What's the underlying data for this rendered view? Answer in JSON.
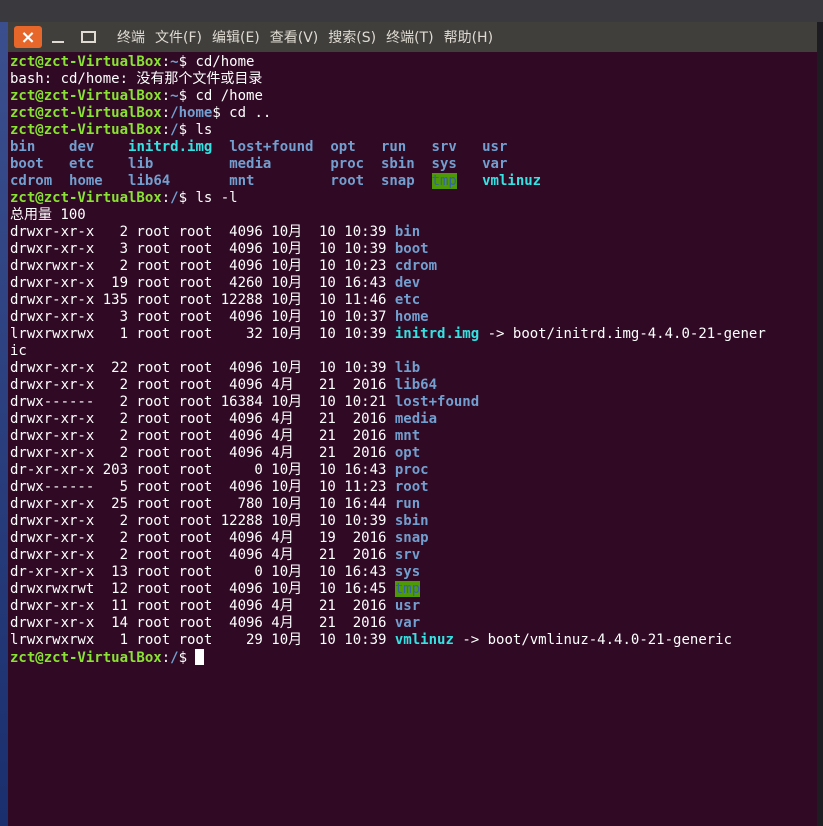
{
  "window": {
    "close_glyph": "×",
    "menu": [
      "终端",
      "文件(F)",
      "编辑(E)",
      "查看(V)",
      "搜索(S)",
      "终端(T)",
      "帮助(H)"
    ]
  },
  "terminal": {
    "lines": [
      [
        [
          "zct@zct-VirtualBox",
          "g"
        ],
        [
          ":",
          ""
        ],
        [
          "~",
          "b"
        ],
        [
          "$ cd/home",
          ""
        ]
      ],
      [
        [
          "bash: cd/home: 没有那个文件或目录",
          ""
        ]
      ],
      [
        [
          "zct@zct-VirtualBox",
          "g"
        ],
        [
          ":",
          ""
        ],
        [
          "~",
          "b"
        ],
        [
          "$ cd /home",
          ""
        ]
      ],
      [
        [
          "zct@zct-VirtualBox",
          "g"
        ],
        [
          ":",
          ""
        ],
        [
          "/home",
          "b"
        ],
        [
          "$ cd ..",
          ""
        ]
      ],
      [
        [
          "zct@zct-VirtualBox",
          "g"
        ],
        [
          ":",
          ""
        ],
        [
          "/",
          "b"
        ],
        [
          "$ ls",
          ""
        ]
      ],
      [
        [
          "bin",
          "b"
        ],
        [
          "    ",
          ""
        ],
        [
          "dev",
          "b"
        ],
        [
          "    ",
          ""
        ],
        [
          "initrd.img",
          "c"
        ],
        [
          "  ",
          ""
        ],
        [
          "lost+found",
          "b"
        ],
        [
          "  ",
          ""
        ],
        [
          "opt",
          "b"
        ],
        [
          "   ",
          ""
        ],
        [
          "run",
          "b"
        ],
        [
          "   ",
          ""
        ],
        [
          "srv",
          "b"
        ],
        [
          "   ",
          ""
        ],
        [
          "usr",
          "b"
        ]
      ],
      [
        [
          "boot",
          "b"
        ],
        [
          "   ",
          ""
        ],
        [
          "etc",
          "b"
        ],
        [
          "    ",
          ""
        ],
        [
          "lib",
          "b"
        ],
        [
          "         ",
          ""
        ],
        [
          "media",
          "b"
        ],
        [
          "       ",
          ""
        ],
        [
          "proc",
          "b"
        ],
        [
          "  ",
          ""
        ],
        [
          "sbin",
          "b"
        ],
        [
          "  ",
          ""
        ],
        [
          "sys",
          "b"
        ],
        [
          "   ",
          ""
        ],
        [
          "var",
          "b"
        ]
      ],
      [
        [
          "cdrom",
          "b"
        ],
        [
          "  ",
          ""
        ],
        [
          "home",
          "b"
        ],
        [
          "   ",
          ""
        ],
        [
          "lib64",
          "b"
        ],
        [
          "       ",
          ""
        ],
        [
          "mnt",
          "b"
        ],
        [
          "         ",
          ""
        ],
        [
          "root",
          "b"
        ],
        [
          "  ",
          ""
        ],
        [
          "snap",
          "b"
        ],
        [
          "  ",
          ""
        ],
        [
          "tmp",
          "hl"
        ],
        [
          "   ",
          ""
        ],
        [
          "vmlinuz",
          "c"
        ]
      ],
      [
        [
          "zct@zct-VirtualBox",
          "g"
        ],
        [
          ":",
          ""
        ],
        [
          "/",
          "b"
        ],
        [
          "$ ls -l",
          ""
        ]
      ],
      [
        [
          "总用量 100",
          ""
        ]
      ],
      [
        [
          "drwxr-xr-x   2 root root  4096 10月  10 10:39 ",
          ""
        ],
        [
          "bin",
          "b"
        ]
      ],
      [
        [
          "drwxr-xr-x   3 root root  4096 10月  10 10:39 ",
          ""
        ],
        [
          "boot",
          "b"
        ]
      ],
      [
        [
          "drwxrwxr-x   2 root root  4096 10月  10 10:23 ",
          ""
        ],
        [
          "cdrom",
          "b"
        ]
      ],
      [
        [
          "drwxr-xr-x  19 root root  4260 10月  10 16:43 ",
          ""
        ],
        [
          "dev",
          "b"
        ]
      ],
      [
        [
          "drwxr-xr-x 135 root root 12288 10月  10 11:46 ",
          ""
        ],
        [
          "etc",
          "b"
        ]
      ],
      [
        [
          "drwxr-xr-x   3 root root  4096 10月  10 10:37 ",
          ""
        ],
        [
          "home",
          "b"
        ]
      ],
      [
        [
          "lrwxrwxrwx   1 root root    32 10月  10 10:39 ",
          ""
        ],
        [
          "initrd.img",
          "c"
        ],
        [
          " -> boot/initrd.img-4.4.0-21-gener",
          ""
        ]
      ],
      [
        [
          "ic",
          ""
        ]
      ],
      [
        [
          "drwxr-xr-x  22 root root  4096 10月  10 10:39 ",
          ""
        ],
        [
          "lib",
          "b"
        ]
      ],
      [
        [
          "drwxr-xr-x   2 root root  4096 4月   21  2016 ",
          ""
        ],
        [
          "lib64",
          "b"
        ]
      ],
      [
        [
          "drwx------   2 root root 16384 10月  10 10:21 ",
          ""
        ],
        [
          "lost+found",
          "b"
        ]
      ],
      [
        [
          "drwxr-xr-x   2 root root  4096 4月   21  2016 ",
          ""
        ],
        [
          "media",
          "b"
        ]
      ],
      [
        [
          "drwxr-xr-x   2 root root  4096 4月   21  2016 ",
          ""
        ],
        [
          "mnt",
          "b"
        ]
      ],
      [
        [
          "drwxr-xr-x   2 root root  4096 4月   21  2016 ",
          ""
        ],
        [
          "opt",
          "b"
        ]
      ],
      [
        [
          "dr-xr-xr-x 203 root root     0 10月  10 16:43 ",
          ""
        ],
        [
          "proc",
          "b"
        ]
      ],
      [
        [
          "drwx------   5 root root  4096 10月  10 11:23 ",
          ""
        ],
        [
          "root",
          "b"
        ]
      ],
      [
        [
          "drwxr-xr-x  25 root root   780 10月  10 16:44 ",
          ""
        ],
        [
          "run",
          "b"
        ]
      ],
      [
        [
          "drwxr-xr-x   2 root root 12288 10月  10 10:39 ",
          ""
        ],
        [
          "sbin",
          "b"
        ]
      ],
      [
        [
          "drwxr-xr-x   2 root root  4096 4月   19  2016 ",
          ""
        ],
        [
          "snap",
          "b"
        ]
      ],
      [
        [
          "drwxr-xr-x   2 root root  4096 4月   21  2016 ",
          ""
        ],
        [
          "srv",
          "b"
        ]
      ],
      [
        [
          "dr-xr-xr-x  13 root root     0 10月  10 16:43 ",
          ""
        ],
        [
          "sys",
          "b"
        ]
      ],
      [
        [
          "drwxrwxrwt  12 root root  4096 10月  10 16:45 ",
          ""
        ],
        [
          "tmp",
          "hl"
        ]
      ],
      [
        [
          "drwxr-xr-x  11 root root  4096 4月   21  2016 ",
          ""
        ],
        [
          "usr",
          "b"
        ]
      ],
      [
        [
          "drwxr-xr-x  14 root root  4096 4月   21  2016 ",
          ""
        ],
        [
          "var",
          "b"
        ]
      ],
      [
        [
          "lrwxrwxrwx   1 root root    29 10月  10 10:39 ",
          ""
        ],
        [
          "vmlinuz",
          "c"
        ],
        [
          " -> boot/vmlinuz-4.4.0-21-generic",
          ""
        ]
      ],
      [
        [
          "zct@zct-VirtualBox",
          "g"
        ],
        [
          ":",
          ""
        ],
        [
          "/",
          "b"
        ],
        [
          "$ ",
          ""
        ]
      ]
    ]
  },
  "colors": {
    "background": "#300a24",
    "prompt": "#8ae234",
    "directory": "#729fcf",
    "symlink": "#34e2e2",
    "sticky_dir_bg": "#4e9a06",
    "close_button": "#e7672b"
  }
}
